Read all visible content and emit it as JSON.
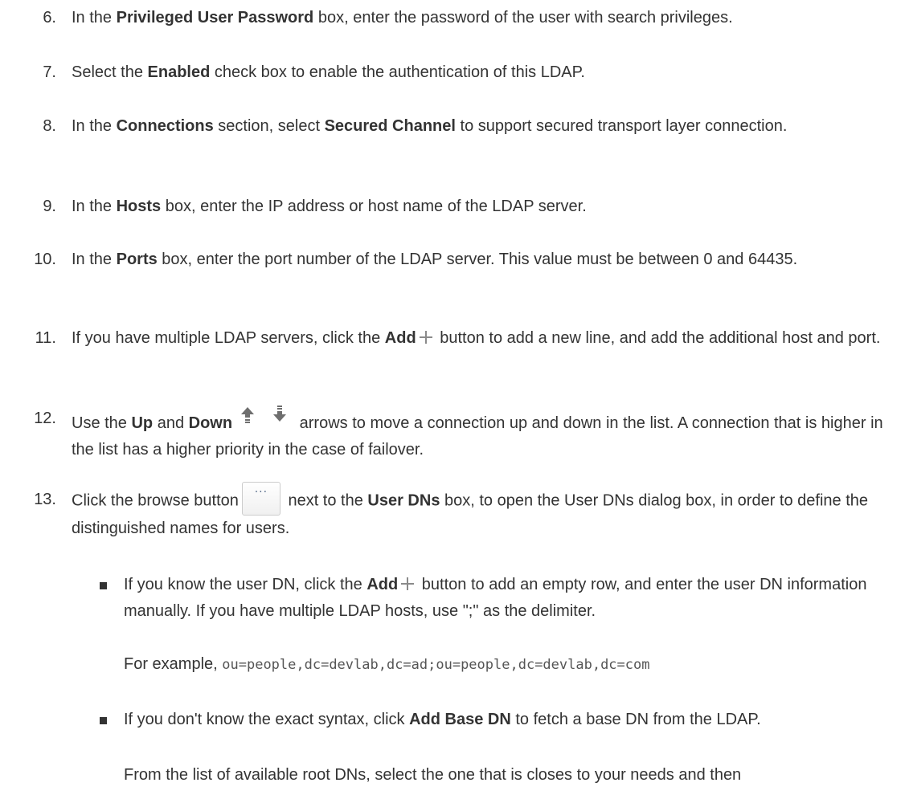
{
  "steps": [
    {
      "num": "6.",
      "pre": "In the ",
      "b1": "Privileged User Password",
      "post": " box, enter the password of the user with search privileges."
    },
    {
      "num": "7.",
      "pre": "Select the ",
      "b1": "Enabled",
      "post": " check box to enable the authentication of this LDAP."
    },
    {
      "num": "8.",
      "pre": "In the ",
      "b1": "Connections",
      "mid": " section, select ",
      "b2": "Secured Channel",
      "post": " to support secured transport layer connection."
    },
    {
      "num": "9.",
      "pre": "In the ",
      "b1": "Hosts",
      "post": " box, enter the IP address or host name of the LDAP server."
    },
    {
      "num": "10.",
      "pre": "In the ",
      "b1": "Ports",
      "post": " box, enter the port number of the LDAP server. This value must be between 0 and 64435."
    },
    {
      "num": "11.",
      "pre": "If you have multiple LDAP servers, click the ",
      "b1": "Add",
      "post": " button to add a new line, and add the additional host and port."
    },
    {
      "num": "12.",
      "pre": "Use the ",
      "b1": "Up",
      "mid": " and ",
      "b2": "Down",
      "post": " arrows to move a connection up and down in the list. A connection that is higher in the list has a higher priority in the case of failover."
    },
    {
      "num": "13.",
      "pre": "Click the browse button",
      "mid": " next to the ",
      "b1": "User DNs",
      "post": " box, to open the User DNs dialog box, in order to define the distinguished names for users."
    }
  ],
  "browse_button_label": "···",
  "bullets": [
    {
      "pre": "If you know the user DN, click the ",
      "b1": "Add",
      "post": " button to add an empty row, and enter the user DN information manually. If you have multiple LDAP hosts, use \";\" as the delimiter."
    },
    {
      "pre": "If you don't know the exact syntax, click ",
      "b1": "Add Base DN",
      "post": " to fetch a base DN from the LDAP."
    }
  ],
  "example": {
    "label": "For example, ",
    "code": "ou=people,dc=devlab,dc=ad;ou=people,dc=devlab,dc=com"
  },
  "trailing": "From the list of available root DNs, select the one that is closes to your needs and then"
}
